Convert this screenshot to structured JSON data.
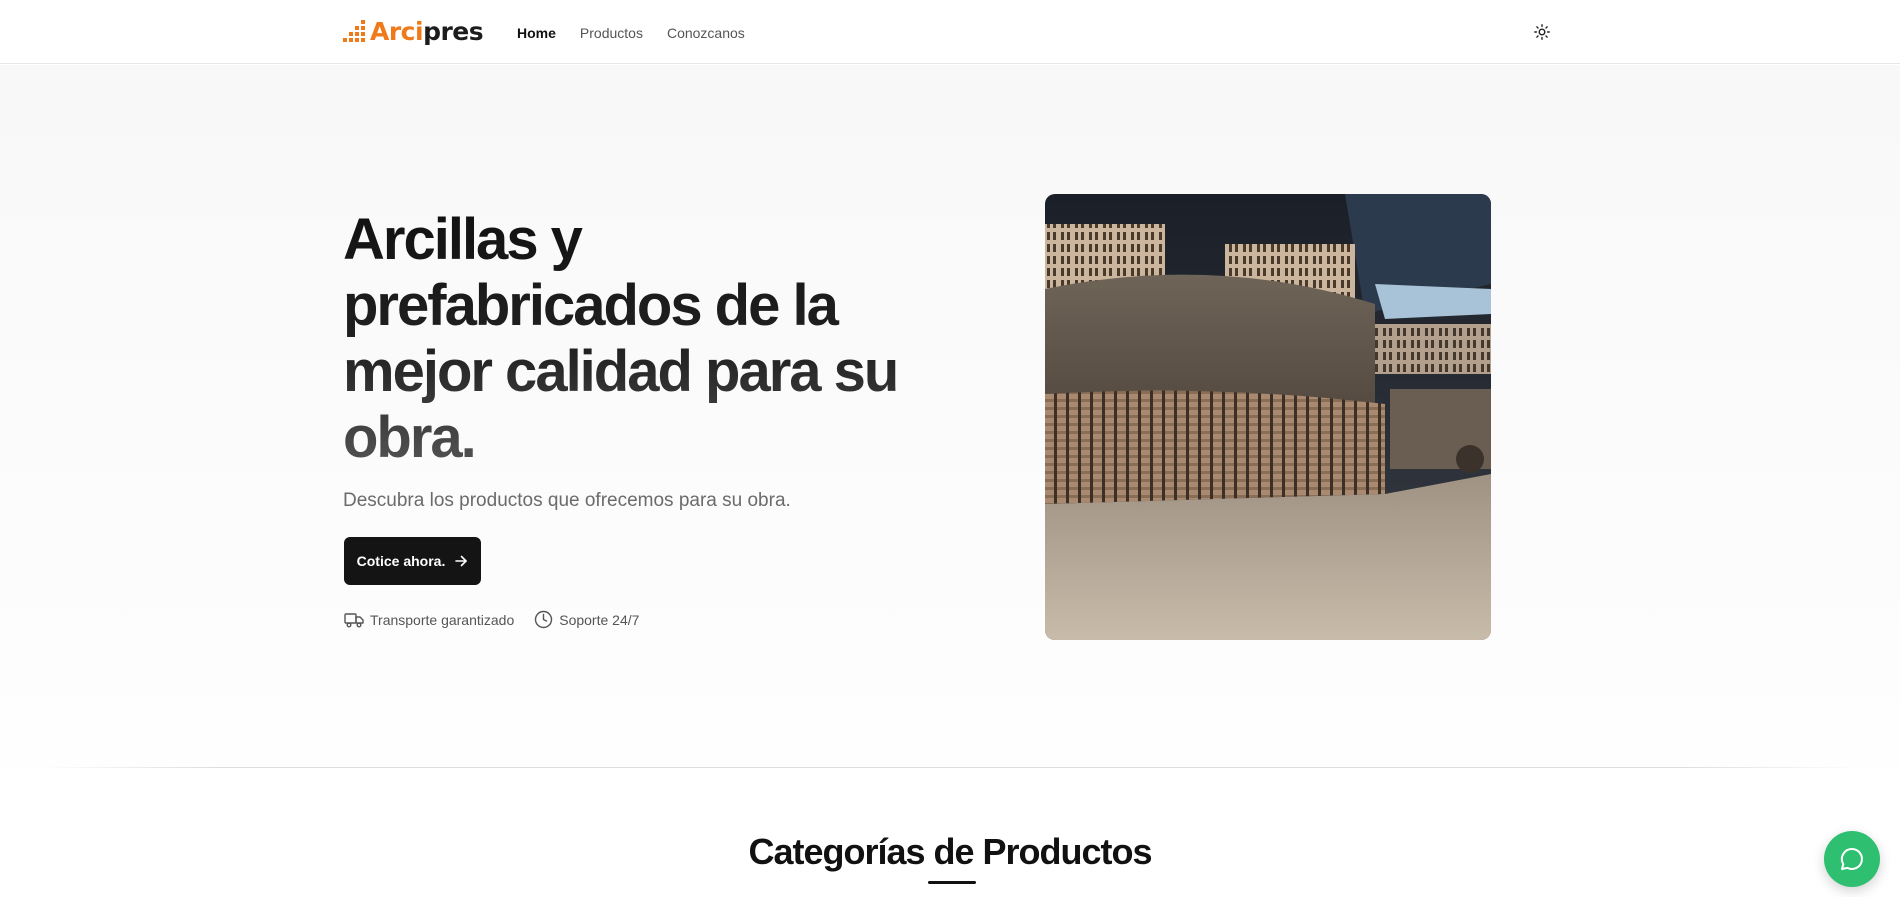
{
  "brand": {
    "name_part1": "Arci",
    "name_part2": "pres",
    "accent_color": "#f07a1a",
    "dark_color": "#1c1c1c"
  },
  "nav": {
    "items": [
      {
        "label": "Home",
        "active": true
      },
      {
        "label": "Productos",
        "active": false
      },
      {
        "label": "Conozcanos",
        "active": false
      }
    ],
    "theme_toggle_icon": "sun-icon"
  },
  "hero": {
    "title": "Arcillas y prefabricados de la mejor calidad para su obra.",
    "subtitle": "Descubra los productos que ofrecemos para su obra.",
    "cta_label": "Cotice ahora.",
    "cta_icon": "arrow-right-icon",
    "features": [
      {
        "icon": "truck-icon",
        "label": "Transporte garantizado"
      },
      {
        "icon": "clock-icon",
        "label": "Soporte 24/7"
      }
    ],
    "image_icon": "brick-kiln-photo"
  },
  "categories": {
    "title": "Categorías de Productos"
  },
  "chat": {
    "icon": "chat-bubble-icon",
    "color": "#2fbf71"
  }
}
